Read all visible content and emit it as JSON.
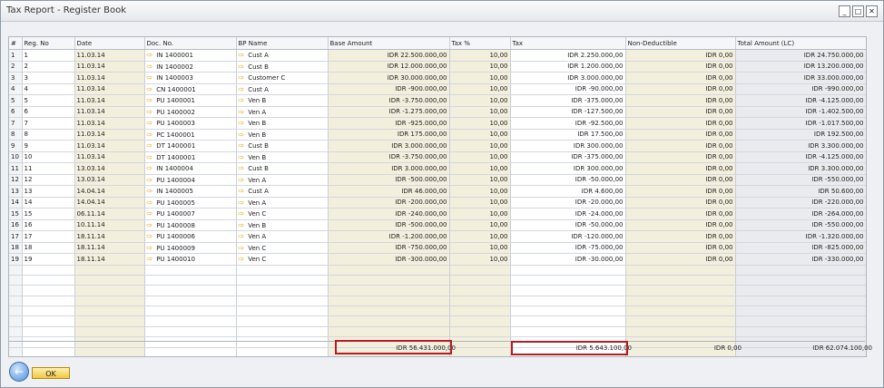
{
  "window": {
    "title": "Tax Report - Register Book",
    "controls": {
      "minimize": "_",
      "maximize": "□",
      "close": "✕"
    }
  },
  "table": {
    "columns": [
      "#",
      "Reg. No",
      "Date",
      "Doc. No.",
      "BP Name",
      "Base Amount",
      "Tax %",
      "Tax",
      "Non-Deductible",
      "Total Amount (LC)"
    ],
    "rows": [
      [
        "1",
        "1",
        "11.03.14",
        "IN 1400001",
        "Cust A",
        "IDR 22.500.000,00",
        "10,00",
        "IDR 2.250.000,00",
        "IDR 0,00",
        "IDR 24.750.000,00"
      ],
      [
        "2",
        "2",
        "11.03.14",
        "IN 1400002",
        "Cust B",
        "IDR 12.000.000,00",
        "10,00",
        "IDR 1.200.000,00",
        "IDR 0,00",
        "IDR 13.200.000,00"
      ],
      [
        "3",
        "3",
        "11.03.14",
        "IN 1400003",
        "Customer C",
        "IDR 30.000.000,00",
        "10,00",
        "IDR 3.000.000,00",
        "IDR 0,00",
        "IDR 33.000.000,00"
      ],
      [
        "4",
        "4",
        "11.03.14",
        "CN 1400001",
        "Cust A",
        "IDR -900.000,00",
        "10,00",
        "IDR -90.000,00",
        "IDR 0,00",
        "IDR -990.000,00"
      ],
      [
        "5",
        "5",
        "11.03.14",
        "PU 1400001",
        "Ven B",
        "IDR -3.750.000,00",
        "10,00",
        "IDR -375.000,00",
        "IDR 0,00",
        "IDR -4.125.000,00"
      ],
      [
        "6",
        "6",
        "11.03.14",
        "PU 1400002",
        "Ven A",
        "IDR -1.275.000,00",
        "10,00",
        "IDR -127.500,00",
        "IDR 0,00",
        "IDR -1.402.500,00"
      ],
      [
        "7",
        "7",
        "11.03.14",
        "PU 1400003",
        "Ven B",
        "IDR -925.000,00",
        "10,00",
        "IDR -92.500,00",
        "IDR 0,00",
        "IDR -1.017.500,00"
      ],
      [
        "8",
        "8",
        "11.03.14",
        "PC 1400001",
        "Ven B",
        "IDR 175.000,00",
        "10,00",
        "IDR 17.500,00",
        "IDR 0,00",
        "IDR 192.500,00"
      ],
      [
        "9",
        "9",
        "11.03.14",
        "DT 1400001",
        "Cust B",
        "IDR 3.000.000,00",
        "10,00",
        "IDR 300.000,00",
        "IDR 0,00",
        "IDR 3.300.000,00"
      ],
      [
        "10",
        "10",
        "11.03.14",
        "DT 1400001",
        "Ven B",
        "IDR -3.750.000,00",
        "10,00",
        "IDR -375.000,00",
        "IDR 0,00",
        "IDR -4.125.000,00"
      ],
      [
        "11",
        "11",
        "13.03.14",
        "IN 1400004",
        "Cust B",
        "IDR 3.000.000,00",
        "10,00",
        "IDR 300.000,00",
        "IDR 0,00",
        "IDR 3.300.000,00"
      ],
      [
        "12",
        "12",
        "13.03.14",
        "PU 1400004",
        "Ven A",
        "IDR -500.000,00",
        "10,00",
        "IDR -50.000,00",
        "IDR 0,00",
        "IDR -550.000,00"
      ],
      [
        "13",
        "13",
        "14.04.14",
        "IN 1400005",
        "Cust A",
        "IDR 46.000,00",
        "10,00",
        "IDR 4.600,00",
        "IDR 0,00",
        "IDR 50.600,00"
      ],
      [
        "14",
        "14",
        "14.04.14",
        "PU 1400005",
        "Ven A",
        "IDR -200.000,00",
        "10,00",
        "IDR -20.000,00",
        "IDR 0,00",
        "IDR -220.000,00"
      ],
      [
        "15",
        "15",
        "06.11.14",
        "PU 1400007",
        "Ven C",
        "IDR -240.000,00",
        "10,00",
        "IDR -24.000,00",
        "IDR 0,00",
        "IDR -264.000,00"
      ],
      [
        "16",
        "16",
        "10.11.14",
        "PU 1400008",
        "Ven B",
        "IDR -500.000,00",
        "10,00",
        "IDR -50.000,00",
        "IDR 0,00",
        "IDR -550.000,00"
      ],
      [
        "17",
        "17",
        "18.11.14",
        "PU 1400006",
        "Ven A",
        "IDR -1.200.000,00",
        "10,00",
        "IDR -120.000,00",
        "IDR 0,00",
        "IDR -1.320.000,00"
      ],
      [
        "18",
        "18",
        "18.11.14",
        "PU 1400009",
        "Ven C",
        "IDR -750.000,00",
        "10,00",
        "IDR -75.000,00",
        "IDR 0,00",
        "IDR -825.000,00"
      ],
      [
        "19",
        "19",
        "18.11.14",
        "PU 1400010",
        "Ven C",
        "IDR -300.000,00",
        "10,00",
        "IDR -30.000,00",
        "IDR 0,00",
        "IDR -330.000,00"
      ]
    ],
    "empty_rows": 9
  },
  "totals": {
    "base_amount": "IDR 56.431.000,00",
    "tax": "IDR 5.643.100,00",
    "non_deductible": "IDR 0,00",
    "total_amount": "IDR 62.074.100,00"
  },
  "buttons": {
    "ok": "OK",
    "back_icon": "←"
  },
  "icons": {
    "link_arrow": "arrow-right-icon"
  },
  "colors": {
    "highlight_box": "#b81c23",
    "editable_cell": "#f3efdd",
    "ok_button": "#f3c640"
  }
}
